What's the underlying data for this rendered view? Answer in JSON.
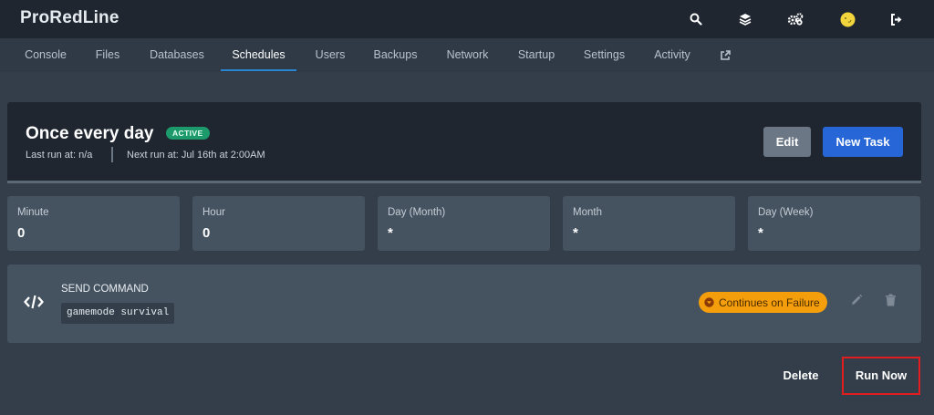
{
  "app": {
    "title": "ProRedLine"
  },
  "topbar_icons": [
    "search-icon",
    "layers-icon",
    "cogs-icon",
    "avatar",
    "sign-out-icon"
  ],
  "nav": {
    "tabs": [
      "Console",
      "Files",
      "Databases",
      "Schedules",
      "Users",
      "Backups",
      "Network",
      "Startup",
      "Settings",
      "Activity"
    ],
    "active_tab": "Schedules",
    "external_icon": "external-link-icon"
  },
  "schedule": {
    "name": "Once every day",
    "status": "ACTIVE",
    "last_run": "Last run at: n/a",
    "next_run": "Next run at: Jul 16th at 2:00AM",
    "edit_label": "Edit",
    "new_task_label": "New Task"
  },
  "cron": [
    {
      "label": "Minute",
      "value": "0"
    },
    {
      "label": "Hour",
      "value": "0"
    },
    {
      "label": "Day (Month)",
      "value": "*"
    },
    {
      "label": "Month",
      "value": "*"
    },
    {
      "label": "Day (Week)",
      "value": "*"
    }
  ],
  "task": {
    "type": "SEND COMMAND",
    "command": "gamemode survival",
    "failure_badge": "Continues on Failure",
    "icon": "code-icon"
  },
  "actions": {
    "delete_label": "Delete",
    "run_now_label": "Run Now"
  },
  "colors": {
    "accent": "#2766d6",
    "active_badge": "#1d9a6c",
    "warning": "#f59e0b",
    "highlight": "#e11d1d"
  }
}
